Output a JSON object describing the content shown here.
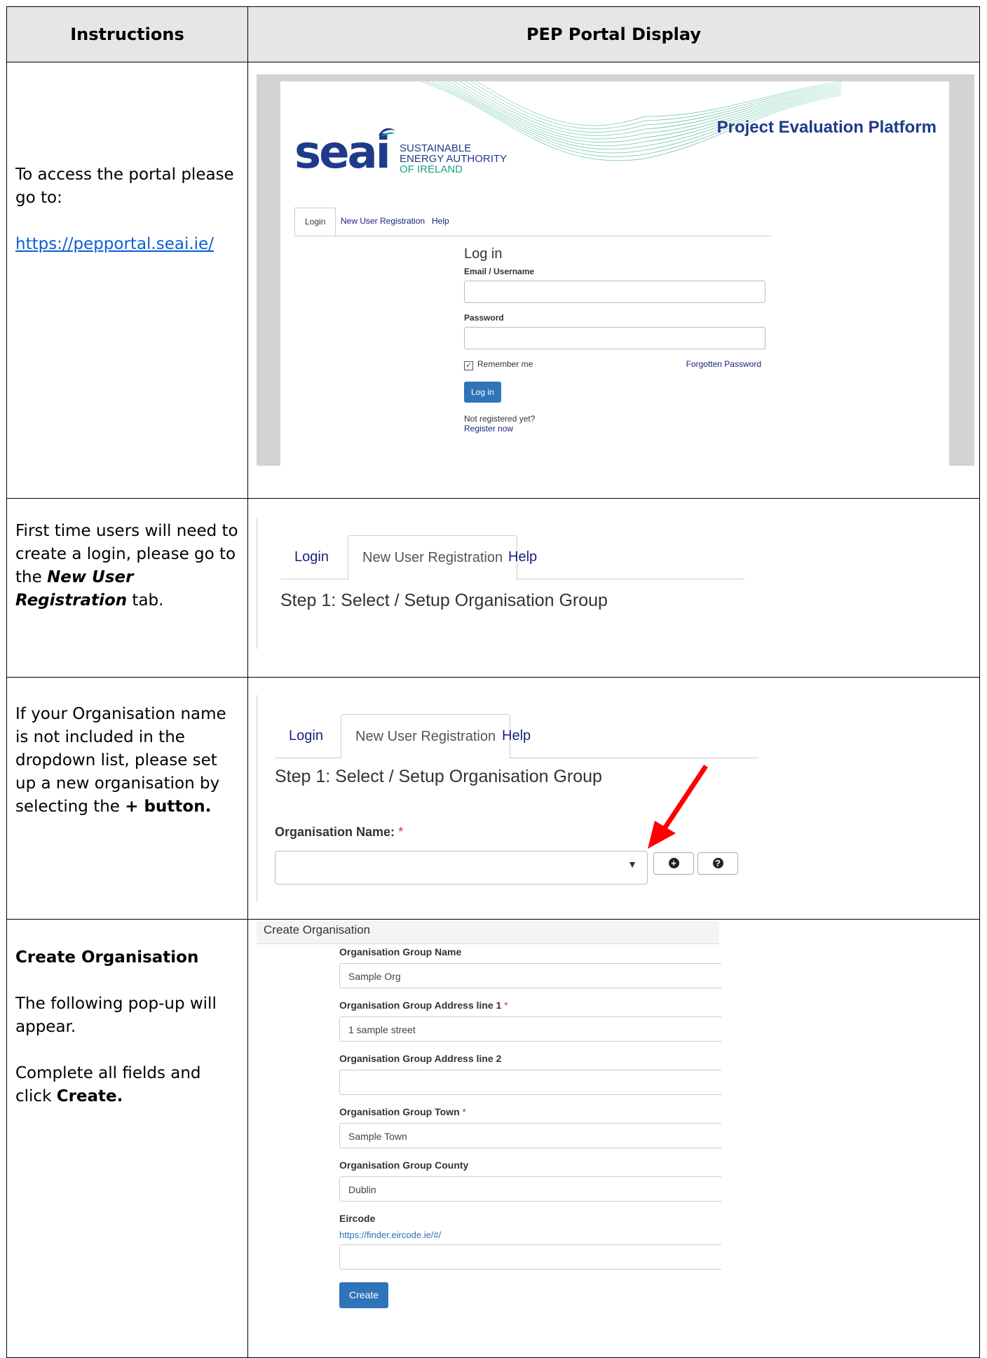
{
  "headers": {
    "instructions": "Instructions",
    "display": "PEP Portal Display"
  },
  "row1": {
    "text1": "To access the portal please go to:",
    "link": "https://pepportal.seai.ie/",
    "screenshot": {
      "platform_title": "Project Evaluation Platform",
      "logo_word": "seai",
      "logo_line1": "SUSTAINABLE",
      "logo_line2": "ENERGY AUTHORITY",
      "logo_line3": "OF IRELAND",
      "tabs": [
        "Login",
        "New User Registration",
        "Help"
      ],
      "form_title": "Log in",
      "email_label": "Email / Username",
      "password_label": "Password",
      "remember": "Remember me",
      "forgot": "Forgotten Password",
      "login_button": "Log in",
      "not_registered": "Not registered yet?",
      "register_now": "Register now"
    }
  },
  "row2": {
    "text_a": "First time users will need to create a login, please go to the ",
    "text_bold": "New User Registration",
    "text_b": " tab.",
    "tabs": [
      "Login",
      "New User Registration",
      "Help"
    ],
    "step": "Step 1: Select / Setup Organisation Group"
  },
  "row3": {
    "text_a": "If your Organisation name is not included in the dropdown list, please set up a new organisation by selecting the ",
    "text_bold": "+ button.",
    "tabs": [
      "Login",
      "New User Registration",
      "Help"
    ],
    "step": "Step 1: Select / Setup Organisation Group",
    "org_label": "Organisation Name:",
    "required_mark": "*"
  },
  "row4": {
    "heading": "Create Organisation",
    "text1": "The following pop-up will appear.",
    "text2a": "Complete all fields and click ",
    "text2b": "Create.",
    "popup_title": "Create Organisation",
    "fields": [
      {
        "label": "Organisation Group Name",
        "required": "",
        "value": "Sample Org"
      },
      {
        "label": "Organisation Group Address line 1",
        "required": "*",
        "value": "1 sample street"
      },
      {
        "label": "Organisation Group Address line 2",
        "required": "",
        "value": ""
      },
      {
        "label": "Organisation Group Town",
        "required": "*",
        "value": "Sample Town"
      },
      {
        "label": "Organisation Group County",
        "required": "",
        "value": "Dublin"
      }
    ],
    "eircode_label": "Eircode",
    "eircode_link": "https://finder.eircode.ie/#/",
    "create_button": "Create"
  },
  "colors": {
    "accent": "#2f74b9",
    "arrow": "#ff0000",
    "navy": "#1e3a8a"
  }
}
